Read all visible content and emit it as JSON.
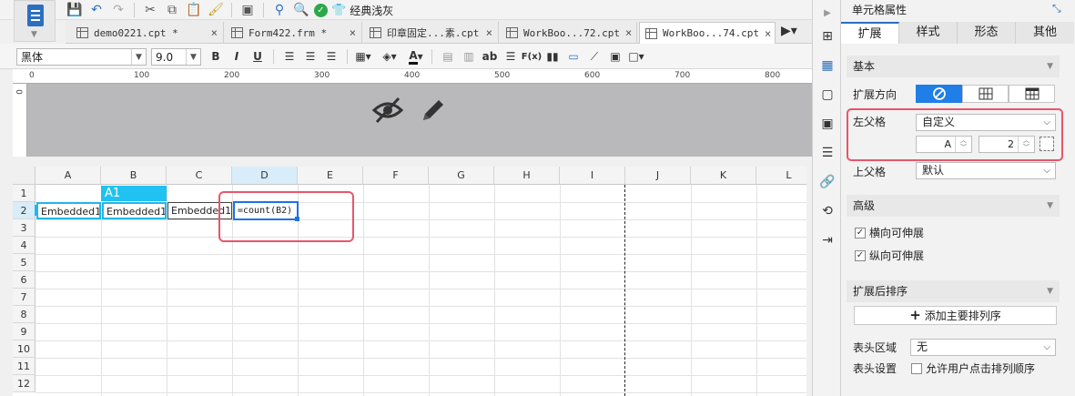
{
  "toolbar": {
    "theme_label": "经典浅灰"
  },
  "tabs": [
    {
      "label": "demo0221.cpt *",
      "close": "×"
    },
    {
      "label": "Form422.frm *",
      "close": "×"
    },
    {
      "label": "印章固定...素.cpt",
      "close": "×"
    },
    {
      "label": "WorkBoo...72.cpt",
      "close": "×"
    },
    {
      "label": "WorkBoo...74.cpt",
      "close": "×"
    }
  ],
  "format": {
    "font_family": "黑体",
    "font_size": "9.0",
    "bold": "B",
    "italic": "I",
    "underline": "U",
    "text_color_letter": "A",
    "wrap_label": "ab",
    "formula_label": "F(x)"
  },
  "ruler": {
    "ticks": [
      "0",
      "100",
      "200",
      "300",
      "400",
      "500",
      "600",
      "700",
      "800"
    ],
    "v_tick": "0"
  },
  "grid": {
    "columns": [
      "A",
      "B",
      "C",
      "D",
      "E",
      "F",
      "G",
      "H",
      "I",
      "J",
      "K",
      "L"
    ],
    "rows": [
      "1",
      "2",
      "3",
      "4",
      "5",
      "6",
      "7",
      "8",
      "9",
      "10",
      "11",
      "12"
    ],
    "selected_column": "D",
    "selected_row": "2",
    "a1_label": "A1",
    "cells": {
      "A2": "Embedded1.",
      "B2": "Embedded1.",
      "C2": "Embedded1",
      "D2": "=count(B2)"
    }
  },
  "panel": {
    "title": "单元格属性",
    "tabs": [
      "扩展",
      "样式",
      "形态",
      "其他"
    ],
    "active_tab": "扩展",
    "section_basic": "基本",
    "expand_direction_label": "扩展方向",
    "left_parent_label": "左父格",
    "left_parent_value": "自定义",
    "left_parent_col": "A",
    "left_parent_row": "2",
    "upper_parent_label": "上父格",
    "upper_parent_value": "默认",
    "section_advanced": "高级",
    "horizontal_expand": "横向可伸展",
    "vertical_expand": "纵向可伸展",
    "section_sort": "扩展后排序",
    "add_sort_button": "添加主要排列序",
    "header_area_label": "表头区域",
    "header_area_value": "无",
    "header_settings_label": "表头设置",
    "allow_click_sort": "允许用户点击排列顺序"
  },
  "colors": {
    "accent": "#1f7ee8",
    "cell_highlight": "#1fc2f0",
    "annotation": "#e8566a",
    "header_area": "#b9b8ba"
  },
  "icons": {
    "toolbar": [
      "save-icon",
      "undo-icon",
      "redo-icon",
      "cut-icon",
      "copy-icon",
      "paste-icon",
      "format-brush-icon",
      "preview-icon",
      "debug-icon",
      "search-icon",
      "check-icon",
      "shirt-icon"
    ],
    "sidebar": [
      "cell-element-icon",
      "cell-attribute-icon",
      "widget-icon",
      "condition-icon",
      "hyperlink-icon",
      "link-icon",
      "data-source-icon",
      "import-icon"
    ]
  }
}
